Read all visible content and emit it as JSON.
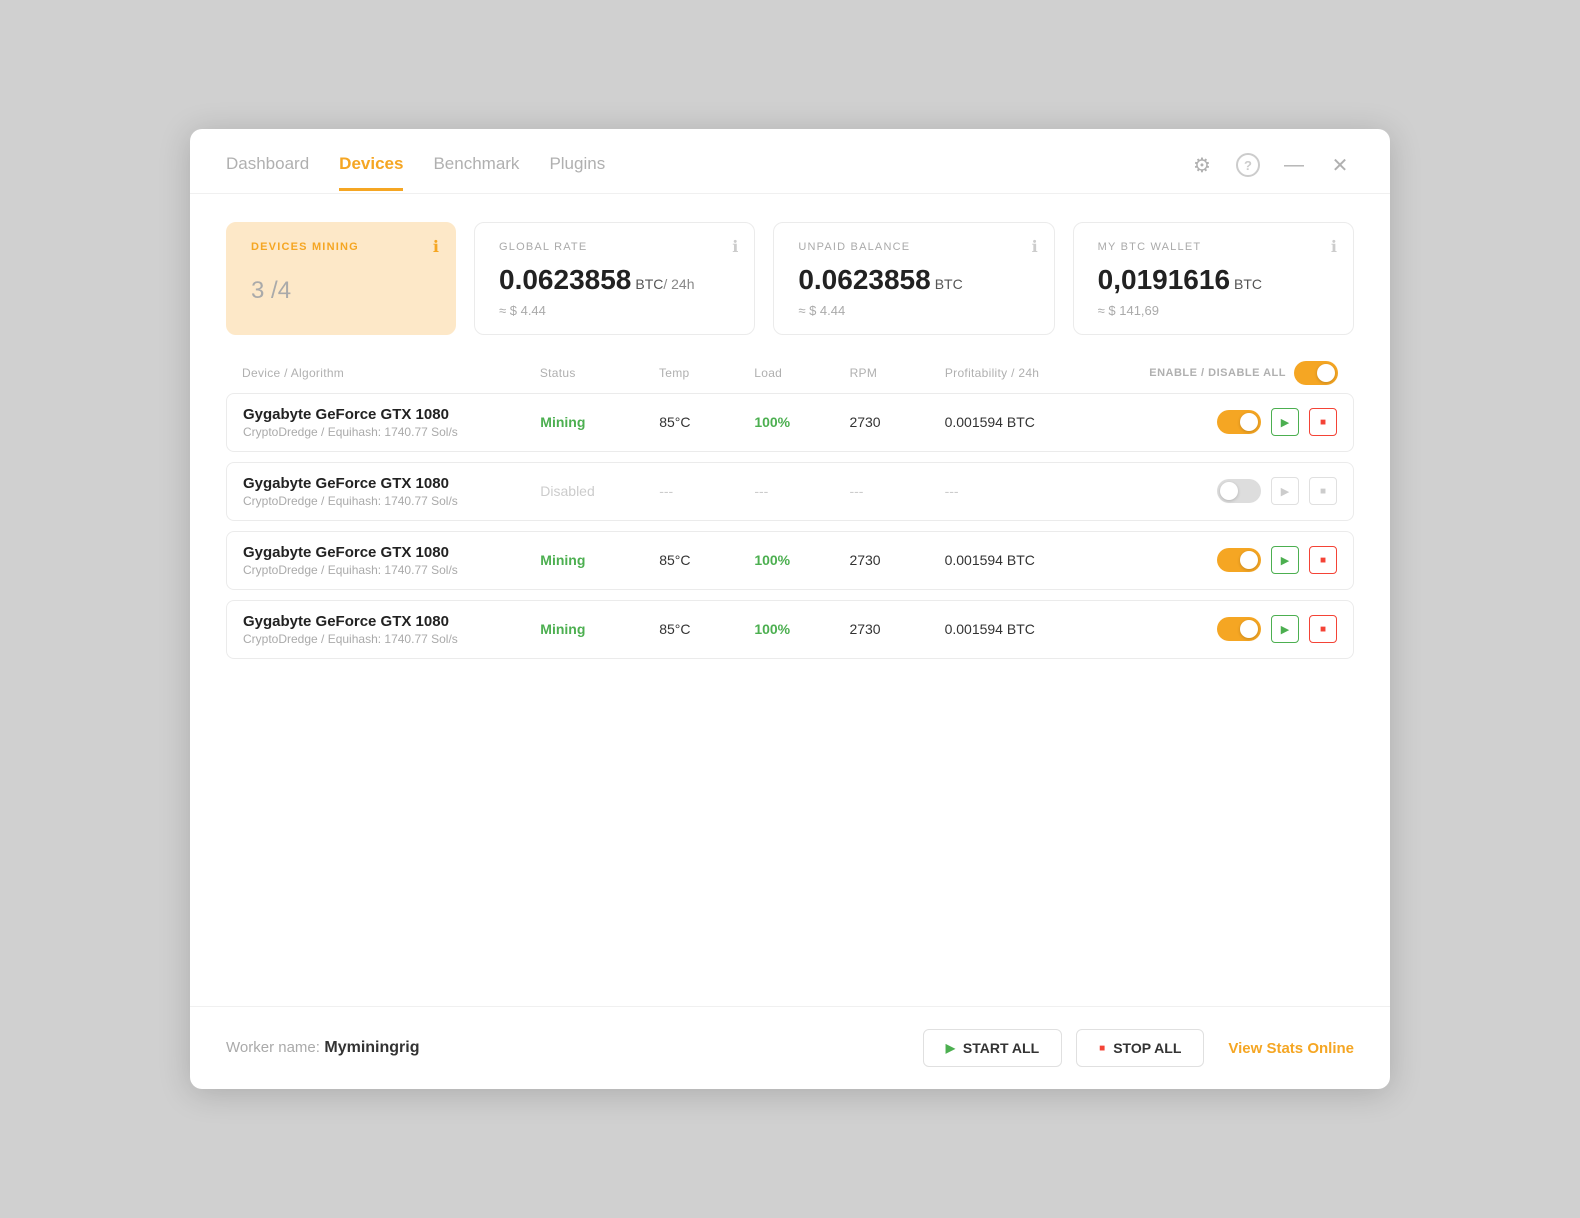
{
  "nav": {
    "tabs": [
      {
        "id": "dashboard",
        "label": "Dashboard",
        "active": false
      },
      {
        "id": "devices",
        "label": "Devices",
        "active": true
      },
      {
        "id": "benchmark",
        "label": "Benchmark",
        "active": false
      },
      {
        "id": "plugins",
        "label": "Plugins",
        "active": false
      }
    ],
    "icons": {
      "settings": "⚙",
      "help": "?",
      "minimize": "—",
      "close": "✕"
    }
  },
  "cards": {
    "devices_mining": {
      "label": "DEVICES MINING",
      "value": "3",
      "slash": "/",
      "total": "4"
    },
    "global_rate": {
      "label": "GLOBAL RATE",
      "value": "0.0623858",
      "unit": "BTC",
      "per": "/ 24h",
      "sub": "≈ $ 4.44"
    },
    "unpaid_balance": {
      "label": "UNPAID BALANCE",
      "value": "0.0623858",
      "unit": "BTC",
      "sub": "≈ $ 4.44"
    },
    "btc_wallet": {
      "label": "MY BTC WALLET",
      "value": "0,0191616",
      "unit": "BTC",
      "sub": "≈ $ 141,69"
    }
  },
  "table": {
    "headers": {
      "device": "Device / Algorithm",
      "status": "Status",
      "temp": "Temp",
      "load": "Load",
      "rpm": "RPM",
      "profit": "Profitability / 24h",
      "enable_all": "ENABLE / DISABLE ALL"
    },
    "rows": [
      {
        "id": 1,
        "name": "Gygabyte GeForce GTX 1080",
        "algo": "CryptoDredge / Equihash: 1740.77 Sol/s",
        "status": "Mining",
        "status_type": "mining",
        "temp": "85°C",
        "load": "100%",
        "rpm": "2730",
        "profit": "0.001594 BTC",
        "enabled": true
      },
      {
        "id": 2,
        "name": "Gygabyte GeForce GTX 1080",
        "algo": "CryptoDredge / Equihash: 1740.77 Sol/s",
        "status": "Disabled",
        "status_type": "disabled",
        "temp": "---",
        "load": "---",
        "rpm": "---",
        "profit": "---",
        "enabled": false
      },
      {
        "id": 3,
        "name": "Gygabyte GeForce GTX 1080",
        "algo": "CryptoDredge / Equihash: 1740.77 Sol/s",
        "status": "Mining",
        "status_type": "mining",
        "temp": "85°C",
        "load": "100%",
        "rpm": "2730",
        "profit": "0.001594 BTC",
        "enabled": true
      },
      {
        "id": 4,
        "name": "Gygabyte GeForce GTX 1080",
        "algo": "CryptoDredge / Equihash: 1740.77 Sol/s",
        "status": "Mining",
        "status_type": "mining",
        "temp": "85°C",
        "load": "100%",
        "rpm": "2730",
        "profit": "0.001594 BTC",
        "enabled": true
      }
    ]
  },
  "footer": {
    "worker_label": "Worker name:",
    "worker_name": "Myminingrig",
    "start_all": "START ALL",
    "stop_all": "STOP ALL",
    "view_stats": "View Stats Online"
  },
  "colors": {
    "orange": "#f5a623",
    "green": "#4caf50",
    "red": "#f44336",
    "gray": "#cccccc"
  }
}
